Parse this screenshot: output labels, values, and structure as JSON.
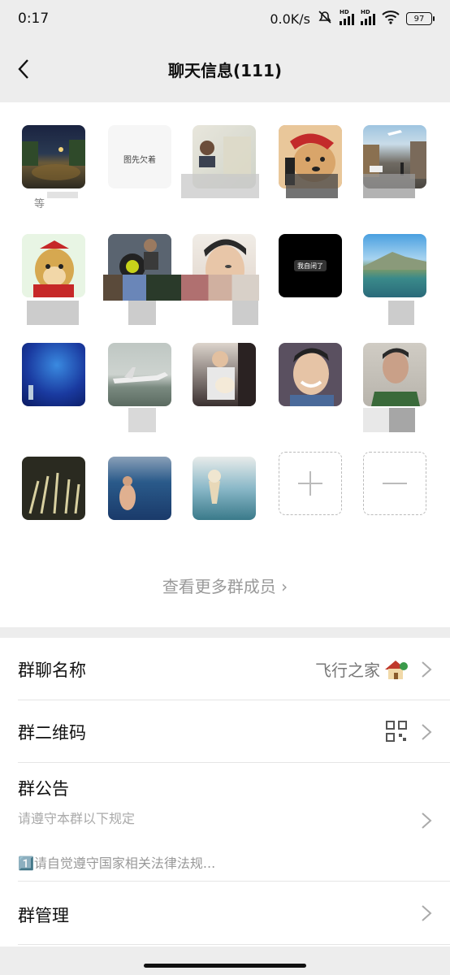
{
  "status": {
    "time": "0:17",
    "speed": "0.0K/s",
    "hd1": "HD",
    "hd2": "HD",
    "battery": "97"
  },
  "nav": {
    "title": "聊天信息(111)"
  },
  "members": {
    "first_name_prefix": "等",
    "screenshot_text_1": "图先欠着",
    "screenshot_text_2": "我自闭了",
    "more_label": "查看更多群成员 ›"
  },
  "info": {
    "group_name_label": "群聊名称",
    "group_name_value": "飞行之家",
    "qr_label": "群二维码",
    "notice_label": "群公告",
    "notice_line1": "请遵守本群以下规定",
    "notice_line2": "1️⃣请自觉遵守国家相关法律法规...",
    "manage_label": "群管理"
  },
  "colors": {
    "background": "#ededed",
    "panel": "#ffffff",
    "secondary_text": "#999999"
  }
}
